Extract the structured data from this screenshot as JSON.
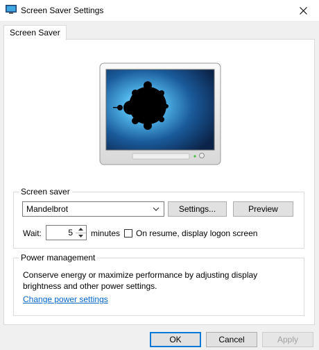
{
  "window": {
    "title": "Screen Saver Settings"
  },
  "tabs": [
    {
      "label": "Screen Saver"
    }
  ],
  "screen_saver": {
    "group_label": "Screen saver",
    "selected": "Mandelbrot",
    "settings_label": "Settings...",
    "preview_label": "Preview",
    "wait_label": "Wait:",
    "wait_value": "5",
    "minutes_label": "minutes",
    "resume_label": "On resume, display logon screen",
    "resume_checked": false
  },
  "power": {
    "group_label": "Power management",
    "description": "Conserve energy or maximize performance by adjusting display brightness and other power settings.",
    "link_label": "Change power settings"
  },
  "footer": {
    "ok_label": "OK",
    "cancel_label": "Cancel",
    "apply_label": "Apply"
  },
  "colors": {
    "accent": "#0078d7",
    "link": "#0066cc",
    "preview_bg": "#1a4a80"
  }
}
